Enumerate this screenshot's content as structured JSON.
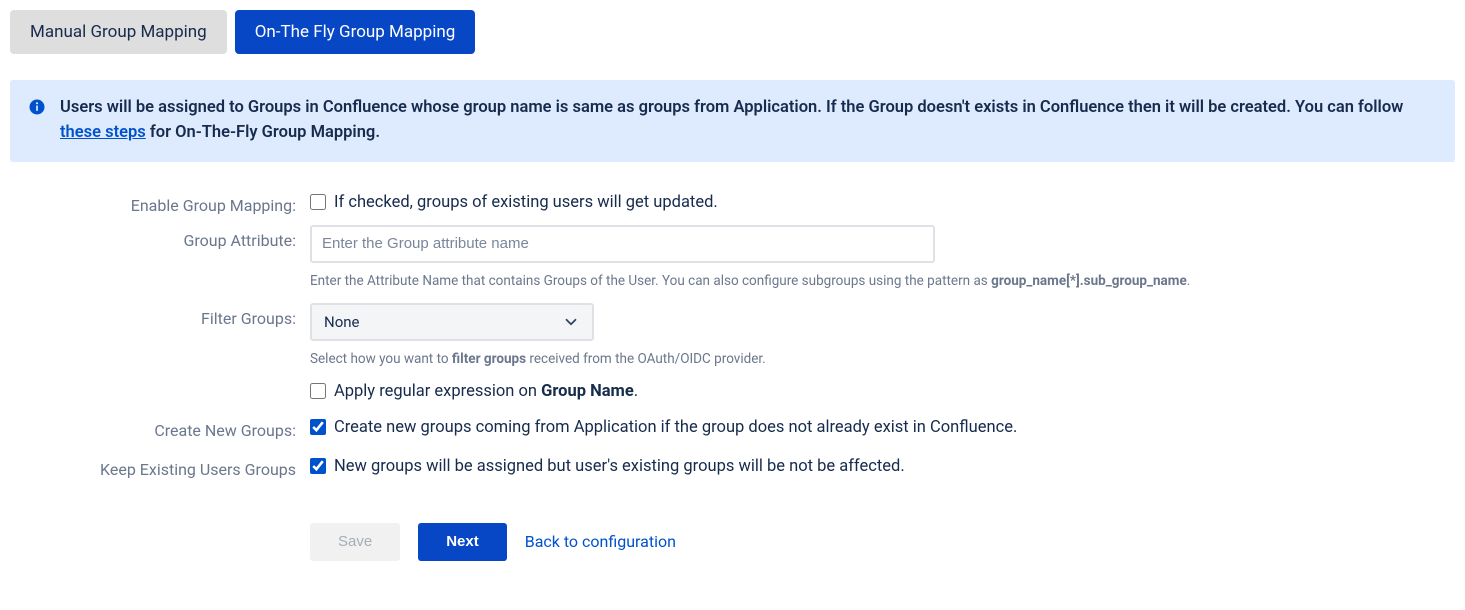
{
  "tabs": {
    "manual": "Manual Group Mapping",
    "otf": "On-The Fly Group Mapping"
  },
  "info": {
    "text_before": "Users will be assigned to Groups in Confluence whose group name is same as groups from Application. If the Group doesn't exists in Confluence then it will be created. You can follow ",
    "link": "these steps",
    "text_after": " for On-The-Fly Group Mapping."
  },
  "form": {
    "enable_label": "Enable Group Mapping:",
    "enable_desc": "If checked, groups of existing users will get updated.",
    "group_attr_label": "Group Attribute:",
    "group_attr_placeholder": "Enter the Group attribute name",
    "group_attr_help_before": "Enter the Attribute Name that contains Groups of the User. You can also configure subgroups using the pattern as ",
    "group_attr_help_strong": "group_name[*].sub_group_name",
    "filter_label": "Filter Groups:",
    "filter_value": "None",
    "filter_help_before": "Select how you want to ",
    "filter_help_strong": "filter groups",
    "filter_help_after": " received from the OAuth/OIDC provider.",
    "regex_before": "Apply regular expression on ",
    "regex_strong": "Group Name",
    "create_label": "Create New Groups:",
    "create_desc": "Create new groups coming from Application if the group does not already exist in Confluence.",
    "keep_label": "Keep Existing Users Groups",
    "keep_desc": "New groups will be assigned but user's existing groups will be not be affected."
  },
  "buttons": {
    "save": "Save",
    "next": "Next",
    "back": "Back to configuration"
  }
}
